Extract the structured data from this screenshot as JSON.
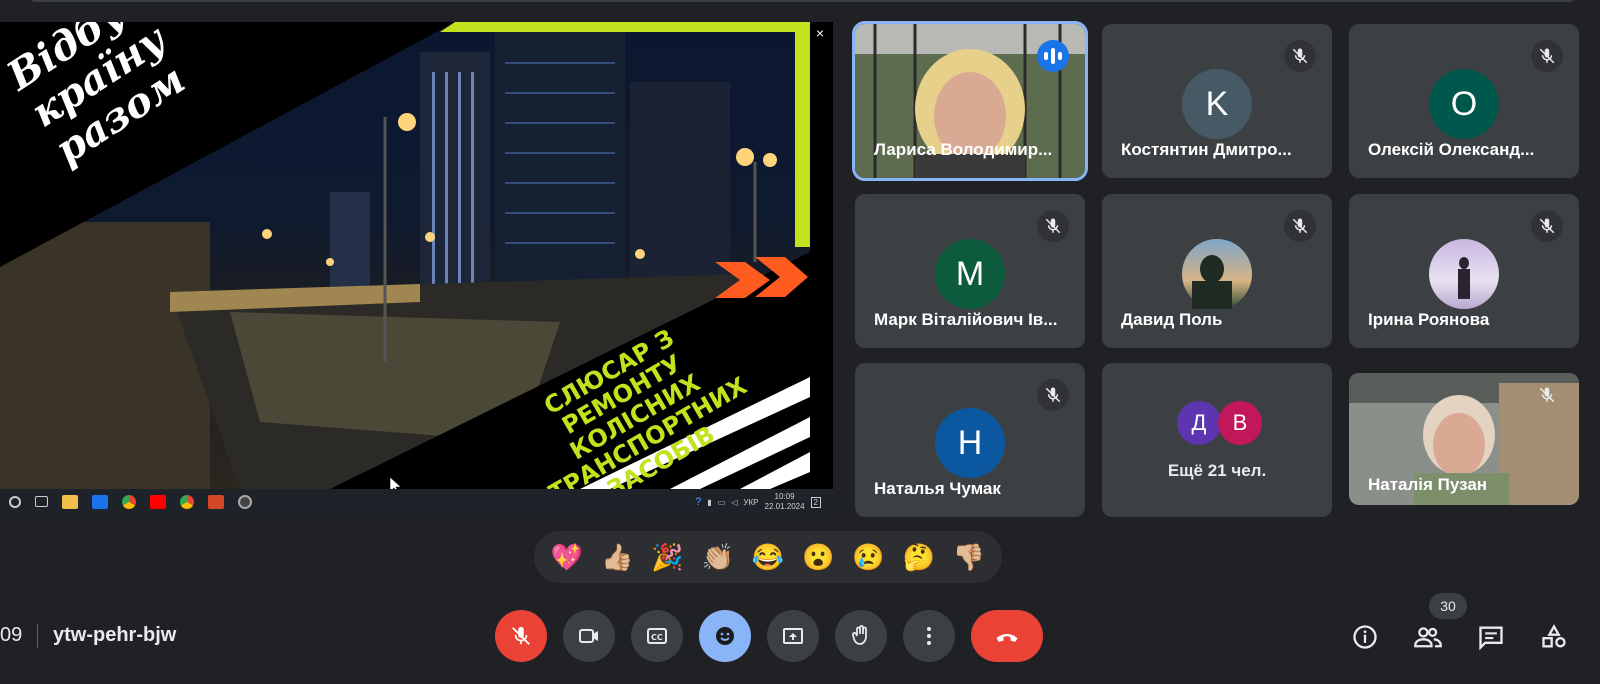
{
  "presentation": {
    "slide_title": "Відбудуємо\nкраїну\nразом",
    "slide_subtitle": "СЛЮСАР З РЕМОНТУ\nКОЛІСНИХ\nТРАНСПОРТНИХ\nЗАСОБІВ",
    "close_glyph": "×",
    "taskbar": {
      "language": "УКР",
      "time": "10:09",
      "date": "22.01.2024",
      "notifications": "2"
    }
  },
  "participants": [
    {
      "name": "Лариса Володимир...",
      "speaking": true
    },
    {
      "name": "Костянтин Дмитро...",
      "initial": "K",
      "avatar_color": "#455a64",
      "muted": true
    },
    {
      "name": "Олексій Олександ...",
      "initial": "O",
      "avatar_color": "#00574b",
      "muted": true
    },
    {
      "name": "Марк Віталійович Ів...",
      "initial": "M",
      "avatar_color": "#0b5b3c",
      "muted": true
    },
    {
      "name": "Давид Поль",
      "muted": true
    },
    {
      "name": "Ірина Роянова",
      "muted": true
    },
    {
      "name": "Наталья Чумак",
      "initial": "H",
      "avatar_color": "#0b57a0",
      "muted": true
    },
    {
      "more_label": "Ещё 21 чел.",
      "initials": [
        "Д",
        "В"
      ],
      "colors": [
        "#5e35b1",
        "#c2185b"
      ]
    },
    {
      "name": "Наталія Пузан",
      "muted": true
    }
  ],
  "reactions": [
    "💖",
    "👍🏼",
    "🎉",
    "👏🏼",
    "😂",
    "😮",
    "😢",
    "🤔",
    "👎🏼"
  ],
  "meeting": {
    "time": "09",
    "code": "ytw-pehr-bjw",
    "participant_count": "30"
  },
  "colors": {
    "background": "#202124",
    "tile": "#3c4043",
    "accent": "#8ab4f8",
    "danger": "#ea4335",
    "slide_accent": "#c4e11d",
    "slide_arrow": "#ff5a1f"
  }
}
